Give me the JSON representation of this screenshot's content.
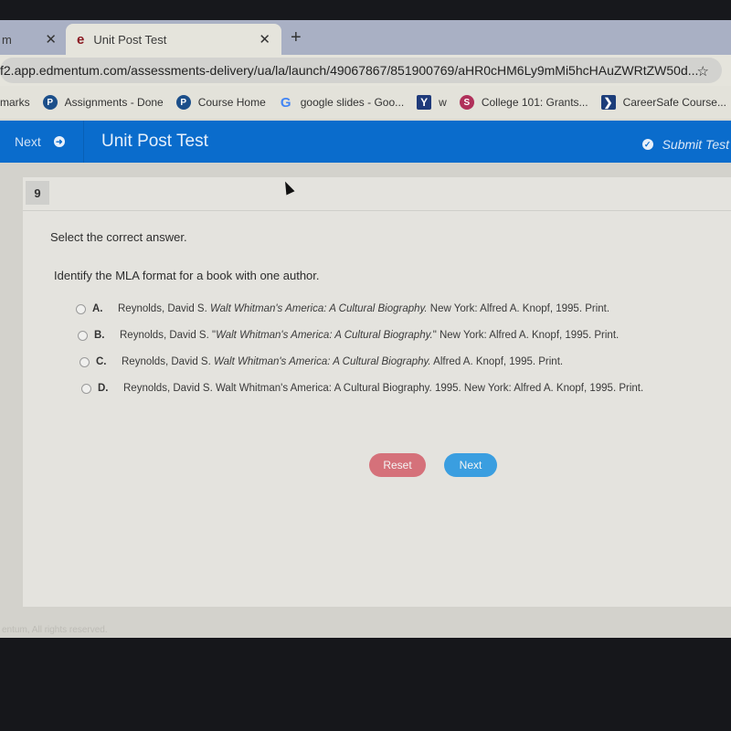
{
  "browser": {
    "tabs": [
      {
        "title": "m",
        "active": false
      },
      {
        "title": "Unit Post Test",
        "active": true,
        "favicon": "edmentum-e-icon"
      }
    ],
    "tab_close_glyph": "✕",
    "new_tab_glyph": "+",
    "favicon_glyph": "e",
    "url": "f2.app.edmentum.com/assessments-delivery/ua/la/launch/49067867/851900769/aHR0cHM6Ly9mMi5hcHAuZWRtZW50d...",
    "star_glyph": "☆",
    "bookmarks": [
      {
        "label": "marks",
        "icon": ""
      },
      {
        "label": "Assignments - Done",
        "icon": "P"
      },
      {
        "label": "Course Home",
        "icon": "P"
      },
      {
        "label": "google slides - Goo...",
        "icon": "G"
      },
      {
        "label": "w",
        "icon": "Y"
      },
      {
        "label": "College 101: Grants...",
        "icon": "S"
      },
      {
        "label": "CareerSafe Course...",
        "icon": "❯"
      }
    ]
  },
  "header": {
    "next_label": "Next",
    "next_icon": "➜",
    "title": "Unit Post Test",
    "submit_label": "Submit Test",
    "submit_icon": "✓"
  },
  "question": {
    "number": "9",
    "instruction": "Select the correct answer.",
    "prompt": "Identify the MLA format for a book with one author.",
    "options": [
      {
        "letter": "A.",
        "pre": "Reynolds, David S. ",
        "italic": "Walt Whitman's America: A Cultural Biography.",
        "post": " New York: Alfred A. Knopf, 1995. Print.",
        "selected": false
      },
      {
        "letter": "B.",
        "pre": "Reynolds, David S. \"",
        "italic": "Walt Whitman's America: A Cultural Biography.",
        "post": "\" New York: Alfred A. Knopf, 1995. Print.",
        "selected": false
      },
      {
        "letter": "C.",
        "pre": "Reynolds, David S. ",
        "italic": "Walt Whitman's America: A Cultural Biography.",
        "post": " Alfred A. Knopf, 1995. Print.",
        "selected": false
      },
      {
        "letter": "D.",
        "pre": "Reynolds, David S. Walt Whitman's America: A Cultural Biography. 1995. New York: Alfred A. Knopf, 1995. Print.",
        "italic": "",
        "post": "",
        "selected": false
      }
    ]
  },
  "actions": {
    "reset_label": "Reset",
    "next_label": "Next"
  },
  "footer": {
    "text": "entum, All rights reserved."
  }
}
